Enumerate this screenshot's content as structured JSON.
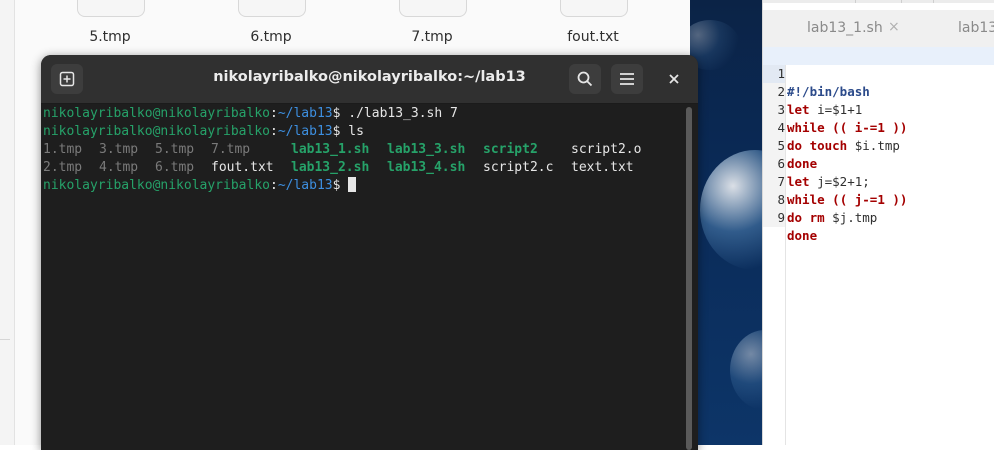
{
  "file_manager": {
    "files": [
      "5.tmp",
      "6.tmp",
      "7.tmp",
      "fout.txt"
    ]
  },
  "terminal": {
    "title": "nikolayribalko@nikolayribalko:~/lab13",
    "new_tab_icon": "new-tab-icon",
    "search_icon": "search-icon",
    "menu_icon": "hamburger-menu-icon",
    "close_icon": "close-icon",
    "prompt_user": "nikolayribalko@nikolayribalko",
    "prompt_sep": ":",
    "prompt_path": "~/lab13",
    "prompt_end": "$",
    "lines": [
      {
        "command": "./lab13_3.sh 7"
      },
      {
        "command": "ls"
      }
    ],
    "ls_row1": [
      "1.tmp",
      "3.tmp",
      "5.tmp",
      "7.tmp",
      "lab13_1.sh",
      "lab13_3.sh",
      "script2",
      "script2.o"
    ],
    "ls_row2": [
      "2.tmp",
      "4.tmp",
      "6.tmp",
      "fout.txt",
      "lab13_2.sh",
      "lab13_4.sh",
      "script2.c",
      "text.txt"
    ]
  },
  "editor": {
    "tabs": [
      {
        "label": "lab13_1.sh",
        "close": "×"
      },
      {
        "label": "lab13_"
      }
    ],
    "lines": [
      {
        "n": "1",
        "text": "#!/bin/bash"
      },
      {
        "n": "2",
        "kw": "let",
        "rest": " i=$1+1"
      },
      {
        "n": "3",
        "kw": "while",
        "rest": " (( i-=1 ))"
      },
      {
        "n": "4",
        "kw": "do touch",
        "rest": " $i.tmp"
      },
      {
        "n": "5",
        "kw": "done",
        "rest": ""
      },
      {
        "n": "6",
        "kw": "let",
        "rest": " j=$2+1;"
      },
      {
        "n": "7",
        "kw": "while",
        "rest": " (( j-=1 ))"
      },
      {
        "n": "8",
        "kw": "do rm",
        "rest": " $j.tmp"
      },
      {
        "n": "9",
        "kw": "done",
        "rest": ""
      }
    ]
  },
  "colors": {
    "terminal_bg": "#1e1e1e",
    "prompt_green": "#26a269",
    "path_blue": "#3d8fe0",
    "keyword_red": "#a40000",
    "shebang_blue": "#2b4a8a"
  }
}
